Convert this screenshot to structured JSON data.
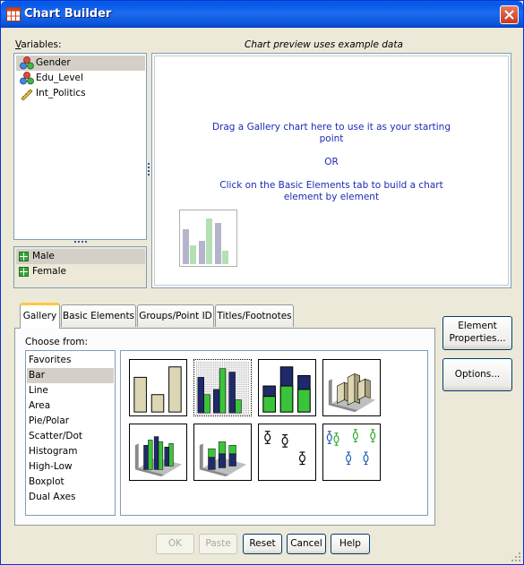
{
  "window": {
    "title": "Chart Builder"
  },
  "variables": {
    "label": "Variables:",
    "items": [
      {
        "label": "Gender",
        "icon": "nominal-icon"
      },
      {
        "label": "Edu_Level",
        "icon": "nominal-icon"
      },
      {
        "label": "Int_Politics",
        "icon": "scale-icon"
      }
    ],
    "categories": [
      {
        "label": "Male"
      },
      {
        "label": "Female"
      }
    ]
  },
  "preview": {
    "caption": "Chart preview uses example data",
    "line1": "Drag a Gallery chart here to use it as your starting",
    "line2": "point",
    "or": "OR",
    "line3": "Click on the Basic Elements tab to build a chart",
    "line4": "element by element"
  },
  "tabs": [
    {
      "label": "Gallery"
    },
    {
      "label": "Basic Elements"
    },
    {
      "label": "Groups/Point ID"
    },
    {
      "label": "Titles/Footnotes"
    }
  ],
  "gallery": {
    "choose_label": "Choose from:",
    "types": [
      "Favorites",
      "Bar",
      "Line",
      "Area",
      "Pie/Polar",
      "Scatter/Dot",
      "Histogram",
      "High-Low",
      "Boxplot",
      "Dual Axes"
    ],
    "selected": "Bar",
    "thumbnails": [
      "simple-bar",
      "clustered-bar",
      "stacked-bar",
      "simple-3d-bar",
      "clustered-3d-bar",
      "stacked-3d-bar",
      "simple-error-bar",
      "clustered-error-bar"
    ]
  },
  "side_buttons": {
    "element_properties_1": "Element",
    "element_properties_2": "Properties...",
    "options": "Options..."
  },
  "footer": {
    "ok": "OK",
    "paste": "Paste",
    "reset": "Reset",
    "cancel": "Cancel",
    "help": "Help"
  },
  "colors": {
    "titlebar": "#0A5FE3",
    "accent_tab": "#FFC83C",
    "preview_text": "#1B2BB5",
    "bar_green": "#3BC43B",
    "bar_navy": "#1F2A6B"
  }
}
